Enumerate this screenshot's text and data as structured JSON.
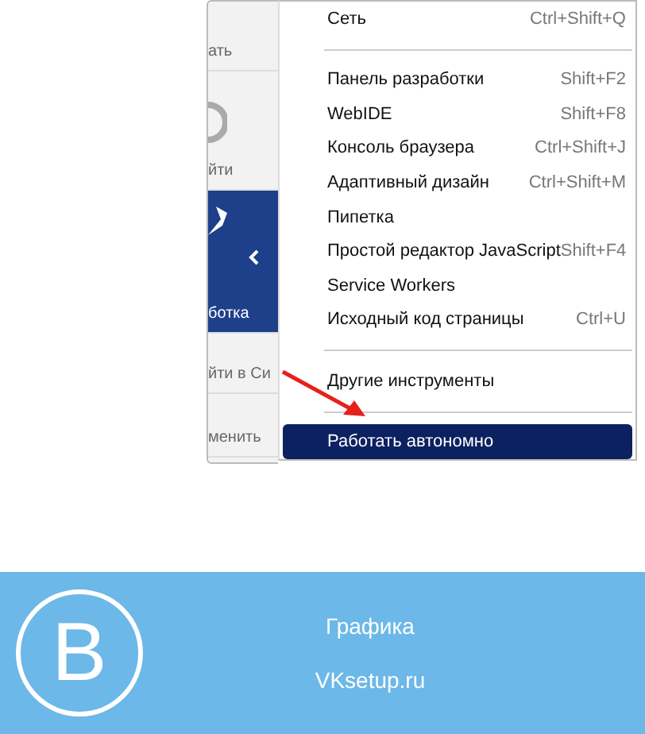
{
  "side_panel": {
    "items": [
      {
        "kind": "text",
        "label": "ать"
      },
      {
        "kind": "icon",
        "label": "йти"
      },
      {
        "kind": "active",
        "label": "ботка"
      },
      {
        "kind": "text",
        "label": "йти в Си"
      },
      {
        "kind": "text",
        "label": "менить"
      }
    ]
  },
  "menu": {
    "items": [
      {
        "kind": "item",
        "label": "Сеть",
        "shortcut": "Ctrl+Shift+Q",
        "selected": false
      },
      {
        "kind": "separator"
      },
      {
        "kind": "item",
        "label": "Панель разработки",
        "shortcut": "Shift+F2",
        "selected": false
      },
      {
        "kind": "item",
        "label": "WebIDE",
        "shortcut": "Shift+F8",
        "selected": false
      },
      {
        "kind": "item",
        "label": "Консоль браузера",
        "shortcut": "Ctrl+Shift+J",
        "selected": false
      },
      {
        "kind": "item",
        "label": "Адаптивный дизайн",
        "shortcut": "Ctrl+Shift+M",
        "selected": false
      },
      {
        "kind": "item",
        "label": "Пипетка",
        "selected": false
      },
      {
        "kind": "item",
        "label": "Простой редактор JavaScript",
        "shortcut": "Shift+F4",
        "selected": false
      },
      {
        "kind": "item",
        "label": "Service Workers",
        "selected": false
      },
      {
        "kind": "item",
        "label": "Исходный код страницы",
        "shortcut": "Ctrl+U",
        "selected": false
      },
      {
        "kind": "separator"
      },
      {
        "kind": "item",
        "label": "Другие инструменты",
        "selected": false
      },
      {
        "kind": "separator"
      },
      {
        "kind": "item",
        "label": "Работать автономно",
        "selected": true
      }
    ]
  },
  "banner": {
    "logo_letter": "B",
    "title": "Графика",
    "site": "VKsetup.ru"
  }
}
